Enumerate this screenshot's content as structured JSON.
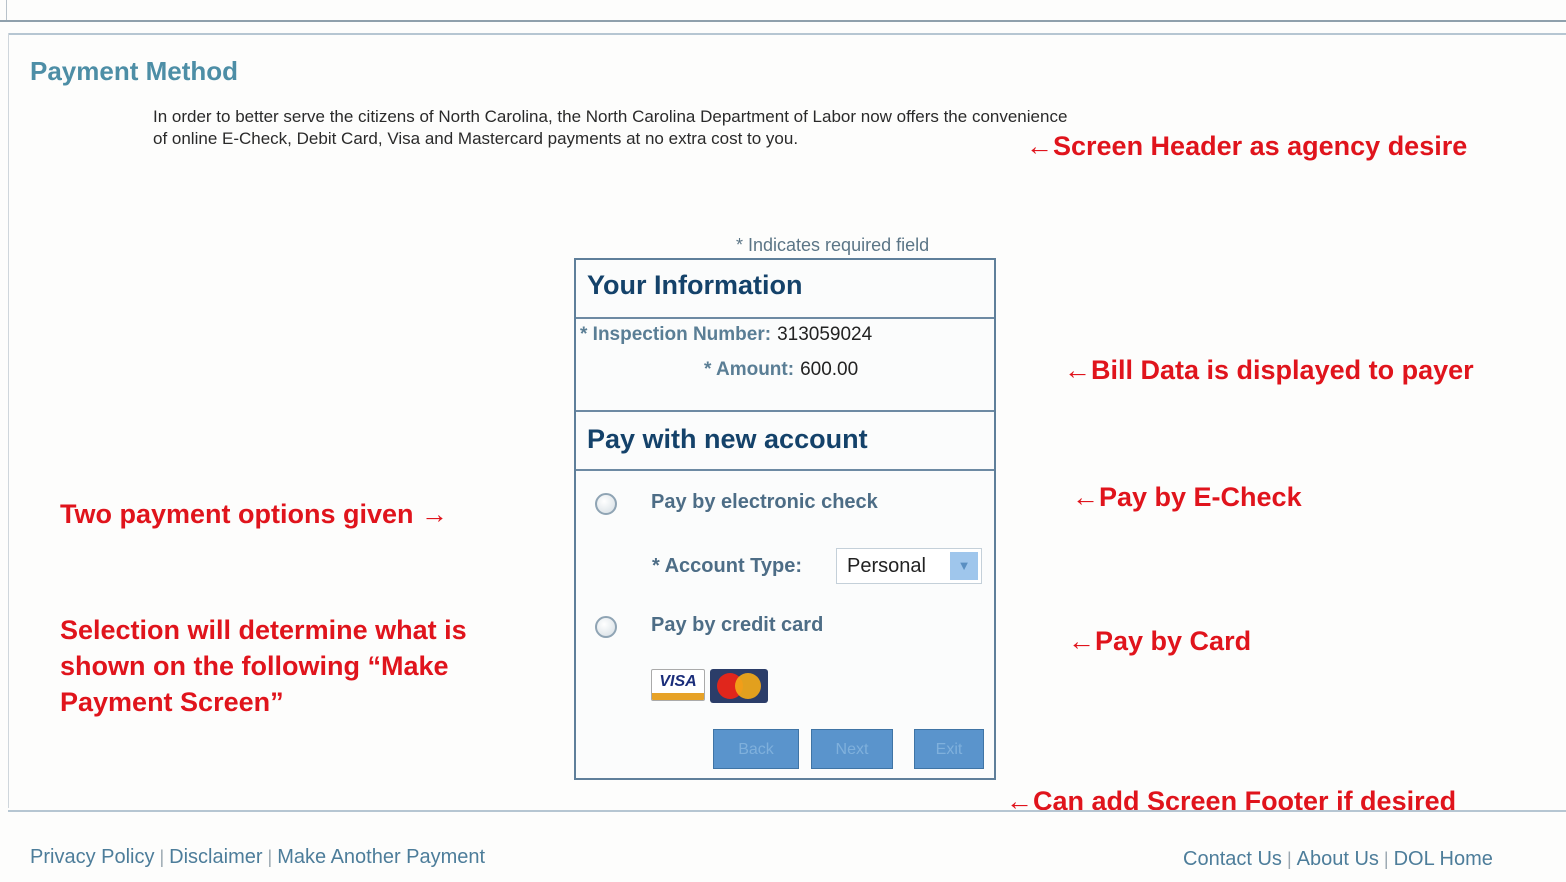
{
  "header": {
    "title": "Payment Method",
    "intro_line1": "In order to better serve the citizens of North Carolina, the North Carolina Department of Labor now offers the convenience",
    "intro_line2": "of online E-Check, Debit Card, Visa and Mastercard payments at no extra cost to you."
  },
  "form": {
    "required_note": "* Indicates required field",
    "your_info_heading": "Your Information",
    "inspection_label": "* Inspection Number:",
    "inspection_value": "313059024",
    "amount_label": "* Amount:",
    "amount_value": "600.00",
    "pay_heading": "Pay with new account",
    "option_echeck": "Pay by electronic check",
    "account_type_label": "* Account Type:",
    "account_type_value": "Personal",
    "option_card": "Pay by credit card",
    "card_visa": "VISA",
    "buttons": {
      "back": "Back",
      "next": "Next",
      "exit": "Exit"
    }
  },
  "annotations": {
    "header_note": "←Screen Header as agency desire",
    "bill_note": "←Bill Data is displayed to payer",
    "echeck_note": "←Pay by E-Check",
    "card_note": "←Pay by Card",
    "options_note": "Two payment options given →",
    "selection_note_line1": "Selection will determine what is",
    "selection_note_line2": "shown on the following “Make",
    "selection_note_line3": "Payment Screen”",
    "footer_note": "←Can add Screen Footer if desired"
  },
  "footer": {
    "left_links": [
      "Privacy Policy",
      "Disclaimer",
      "Make Another Payment"
    ],
    "right_links": [
      "Contact Us",
      "About Us",
      "DOL Home"
    ],
    "separator": "|"
  },
  "colors": {
    "title": "#4d8ea6",
    "annotation": "#e0141c",
    "box_border": "#5f7f9a",
    "heading": "#14426a",
    "button": "#5a94cc",
    "link": "#4d7d9a"
  },
  "icons": [
    "radio-button",
    "select-arrow-icon",
    "visa-logo-icon",
    "mastercard-logo-icon"
  ]
}
